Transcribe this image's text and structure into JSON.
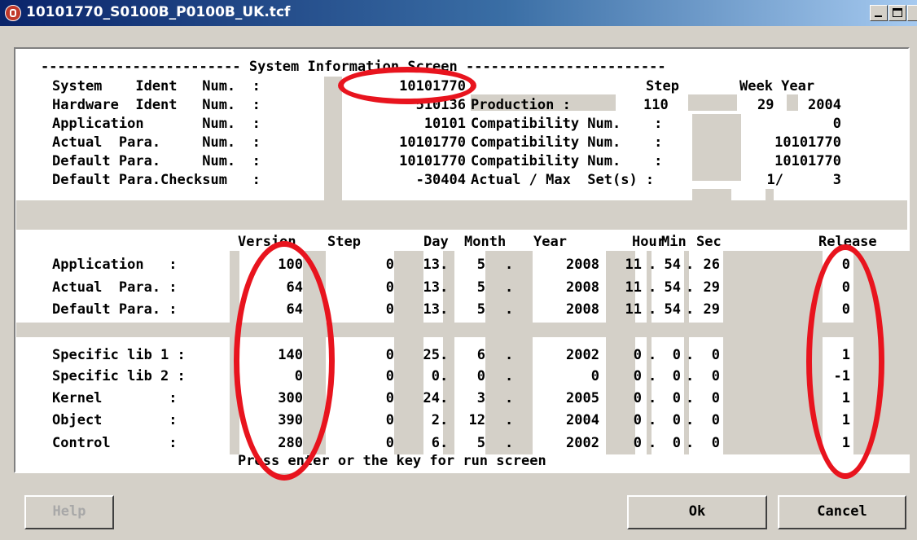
{
  "window": {
    "title": "10101770_S0100B_P0100B_UK.tcf"
  },
  "screen": {
    "header_line": "------------------------ System Information Screen ------------------------",
    "top_rows": [
      {
        "label": "System    Ident   Num.  :",
        "value": "10101770"
      },
      {
        "label": "Hardware  Ident   Num.  :",
        "value": "510136"
      },
      {
        "label": "Application       Num.  :",
        "value": "10101"
      },
      {
        "label": "Actual  Para.     Num.  :",
        "value": "10101770"
      },
      {
        "label": "Default Para.     Num.  :",
        "value": "10101770"
      },
      {
        "label": "Default Para.Checksum   :",
        "value": "-30404"
      }
    ],
    "production": {
      "step_header": "Step",
      "week_year_header": "Week Year",
      "label": "Production :",
      "step": "110",
      "week": "29",
      "year": "2004"
    },
    "compat": [
      {
        "label": "Compatibility Num.    :",
        "value": "0"
      },
      {
        "label": "Compatibility Num.    :",
        "value": "10101770"
      },
      {
        "label": "Compatibility Num.    :",
        "value": "10101770"
      }
    ],
    "sets": {
      "label": "Actual / Max  Set(s) :",
      "actual": "1/",
      "max": "3"
    },
    "version_headers": {
      "version": "Version",
      "step": "Step",
      "day": "Day",
      "month": "Month",
      "year": "Year",
      "hour": "Hour",
      "min": "Min",
      "sec": "Sec",
      "release": "Release"
    },
    "version_rows": [
      {
        "label": "Application   :",
        "version": "100",
        "step": "0",
        "day": "13",
        "month": "5",
        "year": "2008",
        "hour": "11",
        "min": "54",
        "sec": "26",
        "release": "0"
      },
      {
        "label": "Actual  Para. :",
        "version": "64",
        "step": "0",
        "day": "13",
        "month": "5",
        "year": "2008",
        "hour": "11",
        "min": "54",
        "sec": "29",
        "release": "0"
      },
      {
        "label": "Default Para. :",
        "version": "64",
        "step": "0",
        "day": "13",
        "month": "5",
        "year": "2008",
        "hour": "11",
        "min": "54",
        "sec": "29",
        "release": "0"
      },
      {
        "label": "Specific lib 1 :",
        "version": "140",
        "step": "0",
        "day": "25",
        "month": "6",
        "year": "2002",
        "hour": "0",
        "min": "0",
        "sec": "0",
        "release": "1"
      },
      {
        "label": "Specific lib 2 :",
        "version": "0",
        "step": "0",
        "day": "0",
        "month": "0",
        "year": "0",
        "hour": "0",
        "min": "0",
        "sec": "0",
        "release": "-1"
      },
      {
        "label": "Kernel        :",
        "version": "300",
        "step": "0",
        "day": "24",
        "month": "3",
        "year": "2005",
        "hour": "0",
        "min": "0",
        "sec": "0",
        "release": "1"
      },
      {
        "label": "Object        :",
        "version": "390",
        "step": "0",
        "day": "2",
        "month": "12",
        "year": "2004",
        "hour": "0",
        "min": "0",
        "sec": "0",
        "release": "1"
      },
      {
        "label": "Control       :",
        "version": "280",
        "step": "0",
        "day": "6",
        "month": "5",
        "year": "2002",
        "hour": "0",
        "min": "0",
        "sec": "0",
        "release": "1"
      }
    ],
    "footer": "Press enter or the key for run screen"
  },
  "buttons": {
    "help": "Help",
    "ok": "Ok",
    "cancel": "Cancel"
  },
  "colors": {
    "title_bar": "#0a246a",
    "dialog": "#d4d0c8",
    "annotation": "#e8141e"
  }
}
